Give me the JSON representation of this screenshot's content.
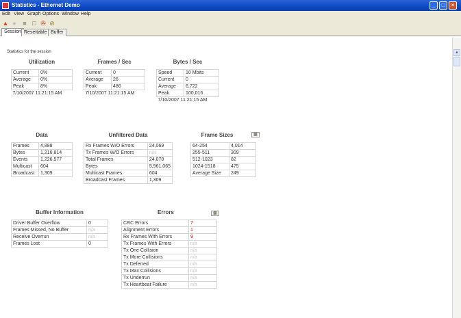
{
  "window": {
    "title": "Statistics - Ethernet Demo",
    "minimize": "_",
    "maximize": "□",
    "close": "×"
  },
  "menu": [
    "Edit",
    "View",
    "Graph",
    "Options",
    "Window",
    "Help"
  ],
  "toolbar_icons": [
    "home-icon",
    "circle-icon",
    "list-icon",
    "clipboard-icon",
    "binoculars-icon",
    "clock-icon"
  ],
  "tabs": [
    "Session",
    "Resettable",
    "Buffer"
  ],
  "note": "Statistics for the session",
  "utilization": {
    "title": "Utilization",
    "rows": [
      [
        "Current",
        "0%"
      ],
      [
        "Average",
        "0%"
      ],
      [
        "Peak",
        "8%"
      ]
    ],
    "timestamp": "7/10/2007 11:21:15 AM"
  },
  "frames_sec": {
    "title": "Frames / Sec",
    "rows": [
      [
        "Current",
        "0"
      ],
      [
        "Average",
        "26"
      ],
      [
        "Peak",
        "486"
      ]
    ],
    "timestamp": "7/10/2007 11:21:15 AM"
  },
  "bytes_sec": {
    "title": "Bytes / Sec",
    "rows": [
      [
        "Speed",
        "10 Mbits"
      ],
      [
        "Current",
        "0"
      ],
      [
        "Average",
        "6,722"
      ],
      [
        "Peak",
        "100,016"
      ]
    ],
    "timestamp": "7/10/2007 11:21:15 AM"
  },
  "data": {
    "title": "Data",
    "rows": [
      [
        "Frames",
        "4,888"
      ],
      [
        "Bytes",
        "1,216,814"
      ],
      [
        "Events",
        "1,226,577"
      ],
      [
        "Multicast",
        "604"
      ],
      [
        "Broadcast",
        "1,309"
      ]
    ]
  },
  "unfiltered": {
    "title": "Unfiltered Data",
    "rows": [
      [
        "Rx Frames W/O Errors",
        "24,069"
      ],
      [
        "Tx Frames W/O Errors",
        "n/a"
      ],
      [
        "Total Frames",
        "24,078"
      ],
      [
        "Bytes",
        "5,961,065"
      ],
      [
        "Multicast Frames",
        "604"
      ],
      [
        "Broadcast Frames",
        "1,309"
      ]
    ]
  },
  "frame_sizes": {
    "title": "Frame Sizes",
    "chart_icon": "bar-chart-icon",
    "rows": [
      [
        "64-254",
        "4,014"
      ],
      [
        "255-511",
        "309"
      ],
      [
        "512-1023",
        "82"
      ],
      [
        "1024-1518",
        "475"
      ],
      [
        "Average Size",
        "249"
      ]
    ]
  },
  "buffer": {
    "title": "Buffer Information",
    "rows": [
      [
        "Driver Buffer Overflow",
        "0"
      ],
      [
        "Frames Missed, No Buffer",
        "n/a"
      ],
      [
        "Receive Overrun",
        "n/a"
      ],
      [
        "Frames Lost",
        "0"
      ]
    ]
  },
  "errors": {
    "title": "Errors",
    "chart_icon": "bar-chart-icon",
    "rows": [
      [
        "CRC Errors",
        "7"
      ],
      [
        "Alignment Errors",
        "1"
      ],
      [
        "Rx Frames With Errors",
        "9"
      ],
      [
        "Tx Frames With Errors",
        "n/a"
      ],
      [
        "Tx One Collision",
        "n/a"
      ],
      [
        "Tx More Collisions",
        "n/a"
      ],
      [
        "Tx Deferred",
        "n/a"
      ],
      [
        "Tx Max Collisions",
        "n/a"
      ],
      [
        "Tx Underrun",
        "n/a"
      ],
      [
        "Tx Heartbeat Failure",
        "n/a"
      ]
    ]
  },
  "colors": {
    "title_bar": "#0d49c4",
    "error_value": "#dd1111",
    "na_value": "#c4c4c4"
  }
}
